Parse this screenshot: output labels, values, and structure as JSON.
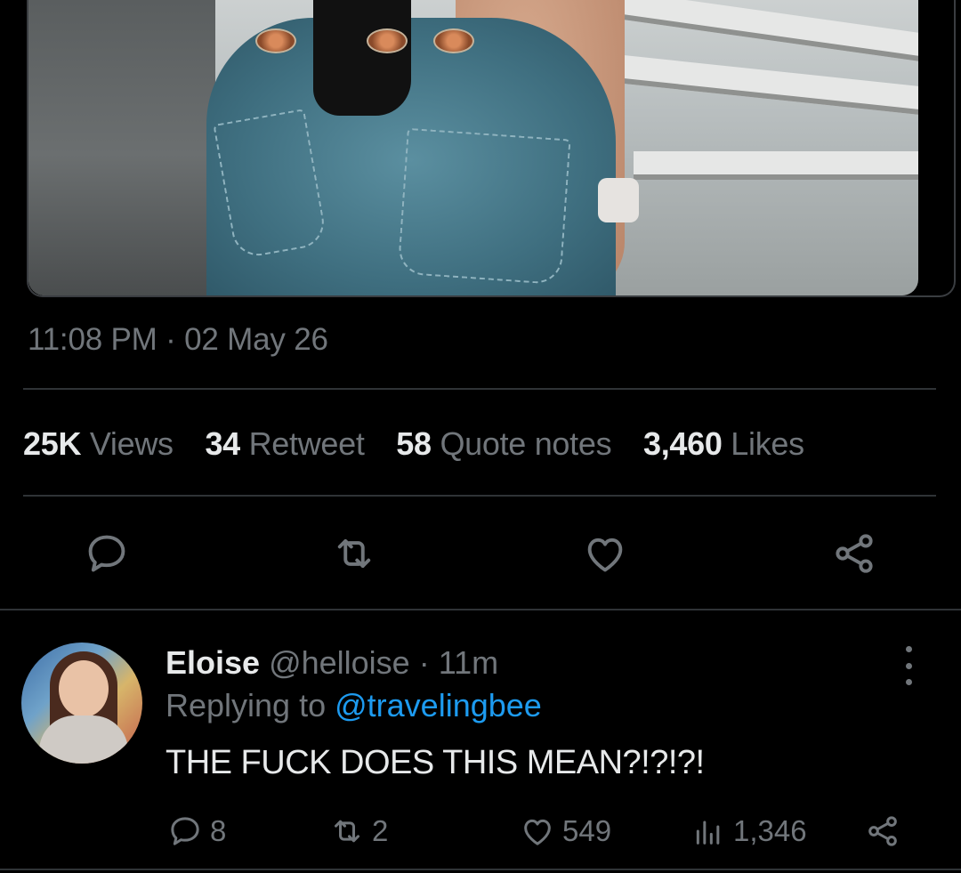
{
  "tweet": {
    "timestamp": "11:08 PM · 02 May 26",
    "stats": [
      {
        "count": "25K",
        "label": "Views"
      },
      {
        "count": "34",
        "label": "Retweet"
      },
      {
        "count": "58",
        "label": "Quote notes"
      },
      {
        "count": "3,460",
        "label": "Likes"
      }
    ],
    "actions": [
      "reply-icon",
      "retweet-icon",
      "like-icon",
      "share-icon"
    ]
  },
  "reply": {
    "name": "Eloise",
    "handle": "@helloise",
    "dot": "·",
    "time": "11m",
    "replying_prefix": "Replying to",
    "replying_to": "@travelingbee",
    "text": "THE FUCK DOES THIS MEAN?!?!?!",
    "counts": {
      "replies": "8",
      "retweets": "2",
      "likes": "549",
      "views": "1,346"
    }
  },
  "colors": {
    "background": "#000000",
    "text": "#e7e9ea",
    "muted": "#71767b",
    "link": "#1d9bf0",
    "divider": "#2f3336"
  }
}
